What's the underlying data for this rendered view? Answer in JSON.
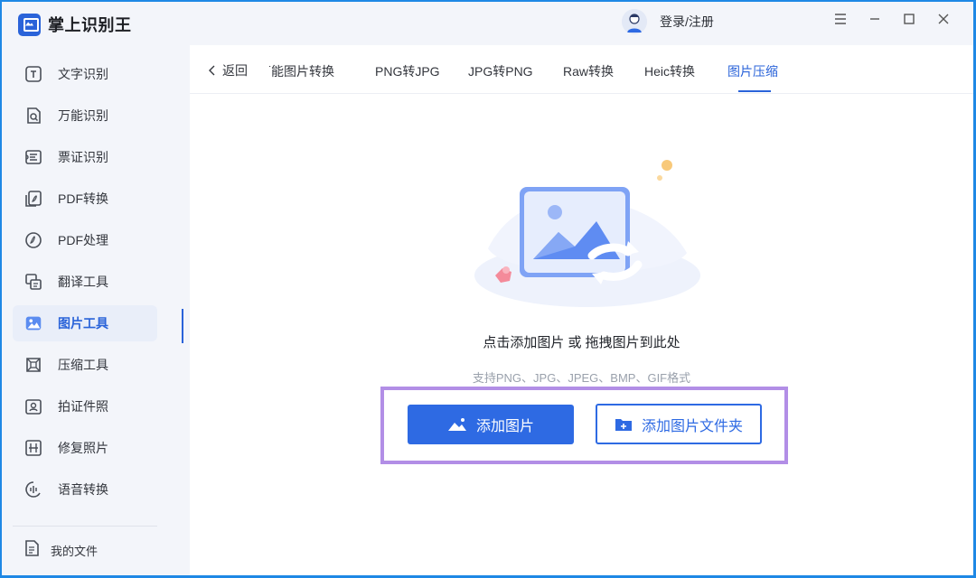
{
  "app": {
    "title": "掌上识别王"
  },
  "sidebar": {
    "items": [
      {
        "label": "文字识别",
        "icon": "text-scan-icon"
      },
      {
        "label": "万能识别",
        "icon": "universal-scan-icon"
      },
      {
        "label": "票证识别",
        "icon": "ticket-icon"
      },
      {
        "label": "PDF转换",
        "icon": "pdf-convert-icon"
      },
      {
        "label": "PDF处理",
        "icon": "pdf-process-icon"
      },
      {
        "label": "翻译工具",
        "icon": "translate-icon"
      },
      {
        "label": "图片工具",
        "icon": "image-tools-icon",
        "active": true
      },
      {
        "label": "压缩工具",
        "icon": "compress-icon"
      },
      {
        "label": "拍证件照",
        "icon": "id-photo-icon"
      },
      {
        "label": "修复照片",
        "icon": "repair-photo-icon"
      },
      {
        "label": "语音转换",
        "icon": "voice-icon"
      }
    ],
    "my_files": "我的文件"
  },
  "titlebar": {
    "login": "登录/注册"
  },
  "tabs": {
    "back": "返回",
    "items": [
      "万能图片转换",
      "PNG转JPG",
      "JPG转PNG",
      "Raw转换",
      "Heic转换",
      "图片压缩"
    ],
    "active_index": 5
  },
  "main": {
    "drop_title": "点击添加图片 或 拖拽图片到此处",
    "drop_subtitle": "支持PNG、JPG、JPEG、BMP、GIF格式",
    "add_image_button": "添加图片",
    "add_folder_button": "添加图片文件夹"
  },
  "colors": {
    "accent": "#2e6ae3",
    "highlight": "#b28ee6",
    "background": "#f3f5fa"
  }
}
